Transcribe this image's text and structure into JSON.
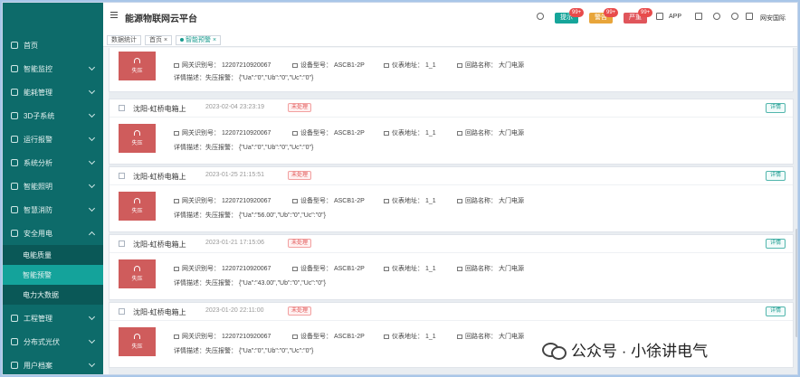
{
  "app": {
    "title": "能源物联网云平台"
  },
  "topbar": {
    "badges": [
      {
        "label": "严重",
        "count": "99+",
        "color": "#e0555b"
      },
      {
        "label": "警告",
        "count": "99+",
        "color": "#e8a53a"
      },
      {
        "label": "提示",
        "count": "99+",
        "color": "#16a59a"
      }
    ],
    "app_label": "APP",
    "user_label": "网安国际"
  },
  "tabs": [
    {
      "label": "数据统计"
    },
    {
      "label": "首页",
      "close": "×"
    },
    {
      "label": "智能预警",
      "close": "×"
    }
  ],
  "sidebar": {
    "items": [
      {
        "label": "首页"
      },
      {
        "label": "智能监控"
      },
      {
        "label": "能耗管理"
      },
      {
        "label": "3D子系统"
      },
      {
        "label": "运行报警"
      },
      {
        "label": "系统分析"
      },
      {
        "label": "智能照明"
      },
      {
        "label": "智慧消防"
      },
      {
        "label": "安全用电"
      },
      {
        "label": "电能质量"
      },
      {
        "label": "智能预警"
      },
      {
        "label": "电力大数据"
      },
      {
        "label": "工程管理"
      },
      {
        "label": "分布式光伏"
      },
      {
        "label": "用户档案"
      }
    ]
  },
  "cards": [
    {
      "title": "",
      "time": "",
      "status": "",
      "detail_btn": "",
      "alarm": "失压",
      "gateway": "网关识别号： 12207210920067",
      "device": "设备型号： ASCB1-2P",
      "address": "仪表地址： 1_1",
      "loop": "回路名称： 大门电源",
      "detail": "详情描述：失压报警： {\"Ua\":\"0\",\"Ub\":\"0\",\"Uc\":\"0\"}"
    },
    {
      "title": "沈阳-虹桥电箱上",
      "time": "2023-02-04 23:23:19",
      "status": "未处理",
      "detail_btn": "详情",
      "alarm": "失压",
      "gateway": "网关识别号： 12207210920067",
      "device": "设备型号： ASCB1-2P",
      "address": "仪表地址： 1_1",
      "loop": "回路名称： 大门电源",
      "detail": "详情描述：失压报警： {\"Ua\":\"0\",\"Ub\":\"0\",\"Uc\":\"0\"}"
    },
    {
      "title": "沈阳-虹桥电箱上",
      "time": "2023-01-25 21:15:51",
      "status": "未处理",
      "detail_btn": "详情",
      "alarm": "失压",
      "gateway": "网关识别号： 12207210920067",
      "device": "设备型号： ASCB1-2P",
      "address": "仪表地址： 1_1",
      "loop": "回路名称： 大门电源",
      "detail": "详情描述：失压报警： {\"Ua\":\"56.00\",\"Ub\":\"0\",\"Uc\":\"0\"}"
    },
    {
      "title": "沈阳-虹桥电箱上",
      "time": "2023-01-21 17:15:06",
      "status": "未处理",
      "detail_btn": "详情",
      "alarm": "失压",
      "gateway": "网关识别号： 12207210920067",
      "device": "设备型号： ASCB1-2P",
      "address": "仪表地址： 1_1",
      "loop": "回路名称： 大门电源",
      "detail": "详情描述：失压报警： {\"Ua\":\"43.00\",\"Ub\":\"0\",\"Uc\":\"0\"}"
    },
    {
      "title": "沈阳-虹桥电箱上",
      "time": "2023-01-20 22:11:00",
      "status": "未处理",
      "detail_btn": "详情",
      "alarm": "失压",
      "gateway": "网关识别号： 12207210920067",
      "device": "设备型号： ASCB1-2P",
      "address": "仪表地址： 1_1",
      "loop": "回路名称： 大门电源",
      "detail": "详情描述：失压报警： {\"Ua\":\"0\",\"Ub\":\"0\",\"Uc\":\"0\"}"
    }
  ],
  "watermark": {
    "text": "公众号 · 小徐讲电气"
  }
}
